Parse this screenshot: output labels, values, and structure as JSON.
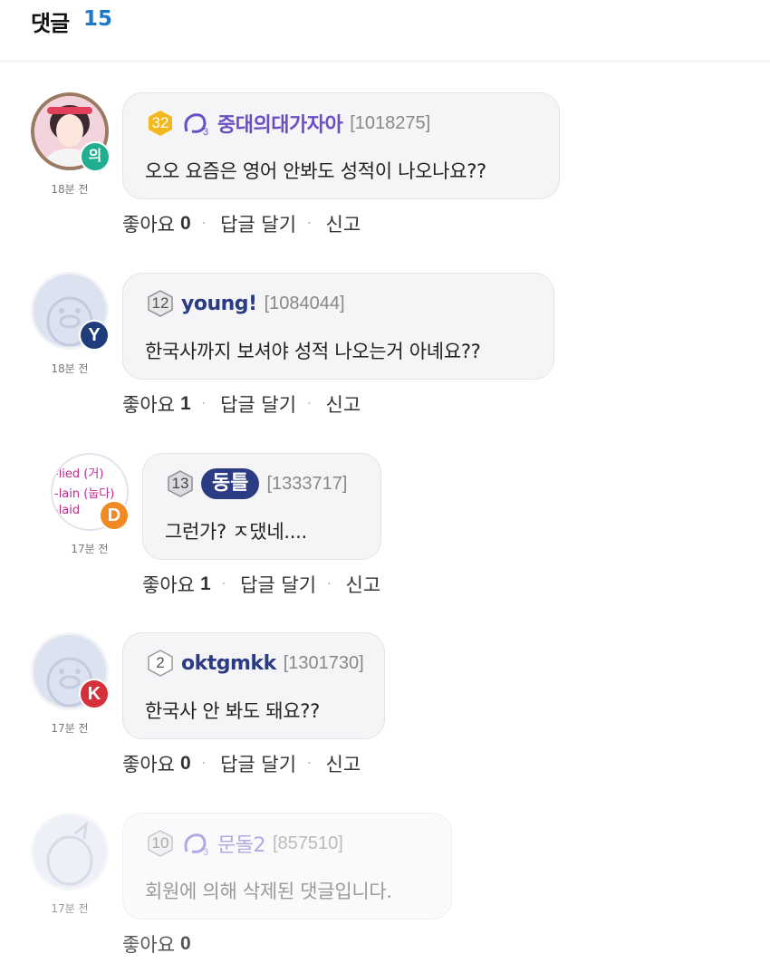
{
  "header": {
    "title": "댓글",
    "count": "15"
  },
  "actions": {
    "like_label": "좋아요",
    "reply_label": "답글 달기",
    "report_label": "신고",
    "separator": "·"
  },
  "comments": [
    {
      "level": "32",
      "nickname": "중대의대가자아",
      "user_id": "[1018275]",
      "text": "오오 요즘은 영어 안봐도 성적이 나오나요??",
      "time": "18분 전",
      "likes": "0",
      "avatar_badge": "의",
      "badge_color": "#1fae8f"
    },
    {
      "level": "12",
      "nickname": "young!",
      "user_id": "[1084044]",
      "text": "한국사까지 보셔야 성적 나오는거 아녜요??",
      "time": "18분 전",
      "likes": "1",
      "avatar_badge": "Y",
      "badge_color": "#1f3d7a"
    },
    {
      "level": "13",
      "nickname": "동틀",
      "user_id": "[1333717]",
      "text": "그런가? ㅈ댔네....",
      "time": "17분 전",
      "likes": "1",
      "avatar_badge": "D",
      "badge_color": "#f08a24",
      "avatar_lines": [
        "-lied (거)",
        "-lain (눕다)",
        "-laid"
      ]
    },
    {
      "level": "2",
      "nickname": "oktgmkk",
      "user_id": "[1301730]",
      "text": "한국사 안 봐도 돼요??",
      "time": "17분 전",
      "likes": "0",
      "avatar_badge": "K",
      "badge_color": "#d6303a"
    },
    {
      "level": "10",
      "nickname": "문돌2",
      "user_id": "[857510]",
      "text": "회원에 의해 삭제된 댓글입니다.",
      "time": "17분 전",
      "likes": "0"
    }
  ],
  "colors": {
    "accent_count": "#1e78c8",
    "nick_purple": "#6a4fc4",
    "nick_navy": "#2b3c84",
    "level_gold": "#f2b81e"
  },
  "icons": {
    "level": "hexagon-level-icon",
    "generation": "o3-generation-icon",
    "default_avatar": "duck-avatar-icon"
  }
}
